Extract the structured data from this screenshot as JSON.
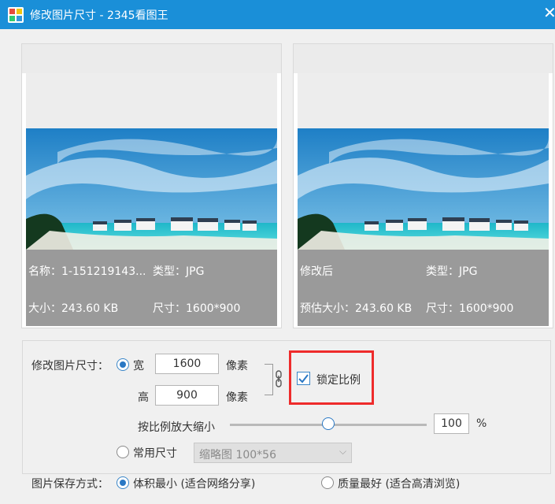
{
  "window": {
    "title": "修改图片尺寸 - 2345看图王"
  },
  "original": {
    "name_label": "名称：",
    "name_value": "1-151219143...",
    "type_label": "类型：",
    "type_value": "JPG",
    "size_label": "大小：",
    "size_value": "243.60 KB",
    "dim_label": "尺寸：",
    "dim_value": "1600*900"
  },
  "modified": {
    "title": "修改后",
    "type_label": "类型：",
    "type_value": "JPG",
    "size_label": "预估大小：",
    "size_value": "243.60 KB",
    "dim_label": "尺寸：",
    "dim_value": "1600*900"
  },
  "resize": {
    "label": "修改图片尺寸：",
    "width_label": "宽",
    "width_value": "1600",
    "width_unit": "像素",
    "height_label": "高",
    "height_value": "900",
    "height_unit": "像素",
    "lock_label": "锁定比例",
    "lock_checked": true,
    "scale_label": "按比例放大缩小",
    "scale_value": "100",
    "scale_unit": "%",
    "scale_fraction": 0.5,
    "preset_label": "常用尺寸",
    "preset_selected": "缩略图 100*56"
  },
  "save": {
    "label": "图片保存方式：",
    "option1": "体积最小 (适合网络分享)",
    "option2": "质量最好 (适合高清浏览)"
  },
  "colors": {
    "titlebar": "#1a8fd8",
    "accent": "#2a78c4",
    "highlight": "#ee2b2b"
  }
}
